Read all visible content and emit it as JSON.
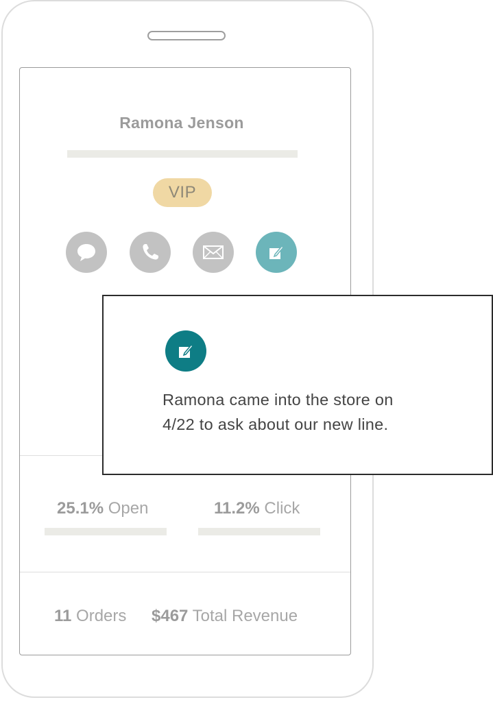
{
  "profile": {
    "name": "Ramona Jenson",
    "badge": "VIP"
  },
  "actions": [
    {
      "name": "message",
      "icon": "chat-bubble-icon"
    },
    {
      "name": "call",
      "icon": "phone-icon"
    },
    {
      "name": "email",
      "icon": "envelope-icon"
    },
    {
      "name": "note",
      "icon": "edit-note-icon"
    }
  ],
  "note_popover": {
    "icon": "edit-note-icon",
    "line1": "Ramona came into the store on",
    "line2": "4/22 to ask about our new line."
  },
  "stats": {
    "open_value": "25.1%",
    "open_label": "Open",
    "click_value": "11.2%",
    "click_label": "Click"
  },
  "totals": {
    "orders_value": "11",
    "orders_label": "Orders",
    "revenue_value": "$467",
    "revenue_label": "Total Revenue"
  },
  "colors": {
    "accent": "#0e7d85",
    "accent_light": "#6cb5ba",
    "vip": "#f0d8a4",
    "muted_icon": "#c2c2c2"
  }
}
